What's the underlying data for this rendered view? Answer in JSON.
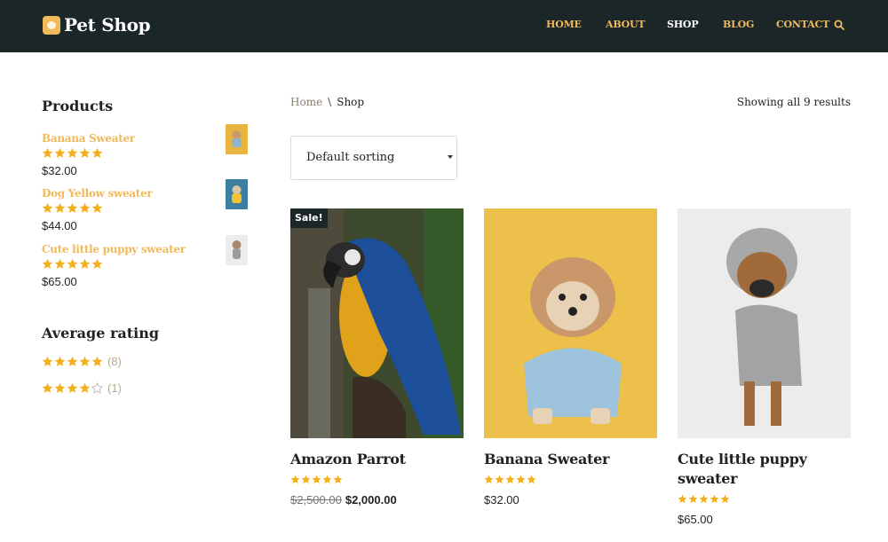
{
  "header": {
    "logo_text": "Pet Shop",
    "nav": [
      {
        "label": "HOME",
        "active": false
      },
      {
        "label": "ABOUT",
        "active": false
      },
      {
        "label": "SHOP",
        "active": true
      },
      {
        "label": "BLOG",
        "active": false
      },
      {
        "label": "CONTACT",
        "active": false
      }
    ],
    "search_icon": "search-icon"
  },
  "sidebar": {
    "products_title": "Products",
    "products": [
      {
        "name": "Banana Sweater",
        "price": "$32.00",
        "rating": 5
      },
      {
        "name": "Dog Yellow sweater",
        "price": "$44.00",
        "rating": 5
      },
      {
        "name": "Cute little puppy sweater",
        "price": "$65.00",
        "rating": 5
      }
    ],
    "rating_title": "Average rating",
    "ratings": [
      {
        "stars": 5,
        "count": "(8)"
      },
      {
        "stars": 4,
        "count": "(1)"
      }
    ]
  },
  "main": {
    "breadcrumb": {
      "home": "Home",
      "separator": "\\",
      "current": "Shop"
    },
    "results_text": "Showing all 9 results",
    "sorting": {
      "selected": "Default sorting"
    },
    "products": [
      {
        "title": "Amazon Parrot",
        "rating": 5,
        "old_price": "$2,500.00",
        "price": "$2,000.00",
        "badge": "Sale!"
      },
      {
        "title": "Banana Sweater",
        "rating": 5,
        "price": "$32.00"
      },
      {
        "title": "Cute little puppy sweater",
        "rating": 5,
        "price": "$65.00"
      }
    ]
  },
  "colors": {
    "header_bg": "#1b2628",
    "accent": "#f0b95c",
    "star": "#f2b01e",
    "text": "#222222"
  }
}
